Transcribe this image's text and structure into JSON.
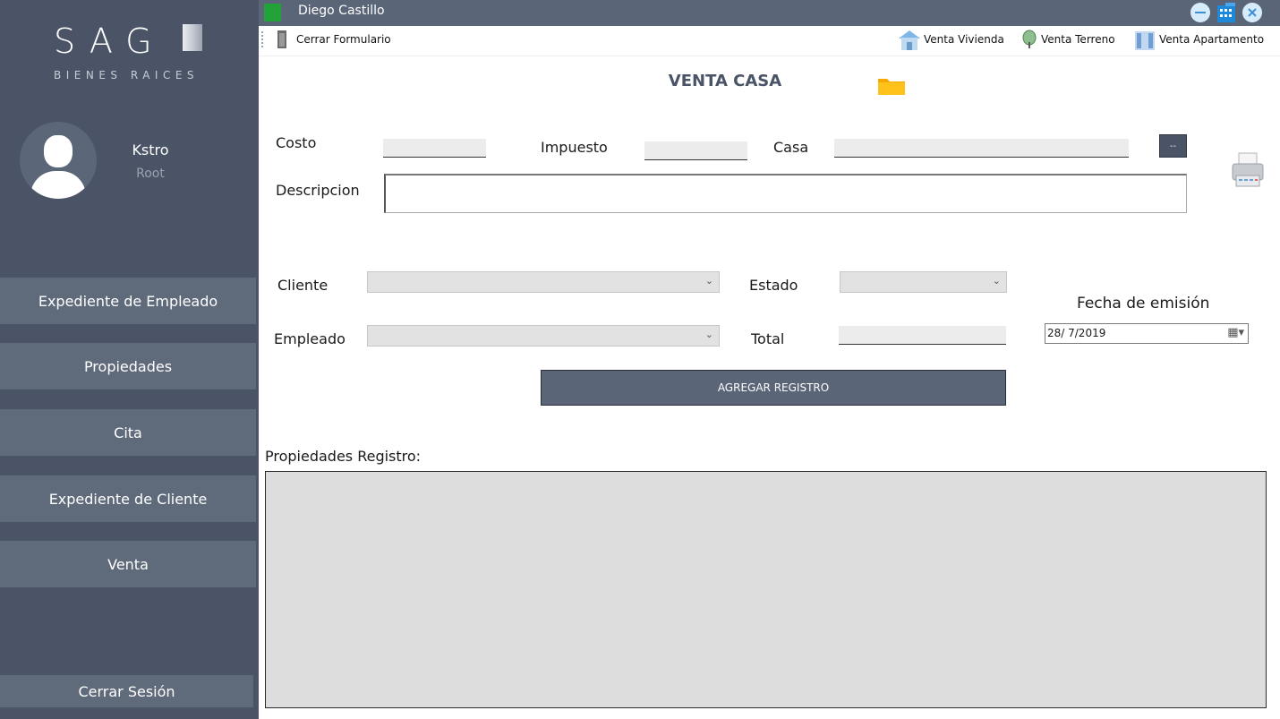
{
  "sidebar": {
    "logo": "SAG",
    "logo_sub": "BIENES RAICES",
    "user": {
      "name": "Kstro",
      "role": "Root"
    },
    "items": [
      {
        "label": "Expediente de Empleado"
      },
      {
        "label": "Propiedades"
      },
      {
        "label": "Cita"
      },
      {
        "label": "Expediente de Cliente"
      },
      {
        "label": "Venta"
      }
    ],
    "logout": "Cerrar Sesión"
  },
  "titlebar": {
    "title": "Diego Castillo"
  },
  "toolstrip": {
    "close_form": "Cerrar Formulario",
    "venta_vivienda": "Venta Vivienda",
    "venta_terreno": "Venta Terreno",
    "venta_apartamento": "Venta Apartamento"
  },
  "form": {
    "title": "VENTA CASA",
    "labels": {
      "costo": "Costo",
      "impuesto": "Impuesto",
      "casa": "Casa",
      "descripcion": "Descripcion",
      "cliente": "Cliente",
      "estado": "Estado",
      "empleado": "Empleado",
      "total": "Total",
      "fecha": "Fecha de emisión"
    },
    "browse_button": "--",
    "date_value": "28/ 7/2019",
    "add_button": "AGREGAR REGISTRO",
    "grid_label": "Propiedades Registro:"
  },
  "colors": {
    "sidebar_bg": "#4a5466",
    "nav_button": "#5f6a7b",
    "titlebar": "#5a6577",
    "accent_green": "#22a33a"
  }
}
